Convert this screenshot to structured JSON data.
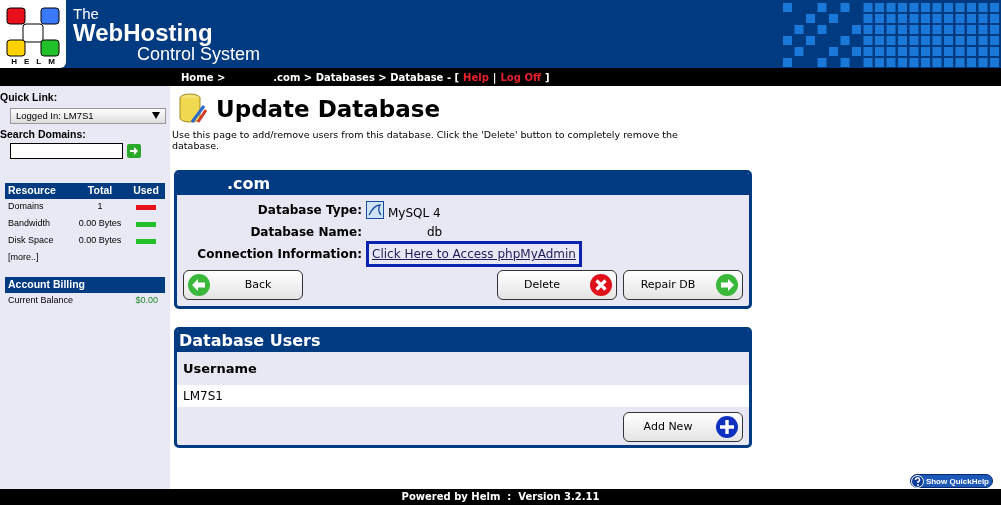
{
  "header": {
    "logo_text": "HELM",
    "title_lines": [
      "The",
      "WebHosting",
      "Control System"
    ]
  },
  "breadcrumb": [
    {
      "text": "Home >",
      "kind": "plain"
    },
    {
      "text": ".com > Databases > Database - [",
      "kind": "plain"
    },
    {
      "text": "Help",
      "kind": "link"
    },
    {
      "text": "|",
      "kind": "sep"
    },
    {
      "text": "Log Off",
      "kind": "link"
    },
    {
      "text": "]",
      "kind": "plain"
    }
  ],
  "sidebar": {
    "quick_link": {
      "label": "Quick Link:",
      "value": "Logged In: LM7S1"
    },
    "search": {
      "label": "Search Domains:"
    },
    "resources": {
      "columns": [
        "Resource",
        "Total",
        "Used"
      ],
      "rows": [
        {
          "name": "Domains",
          "total": "1",
          "color": "#e8101a"
        },
        {
          "name": "Bandwidth",
          "total": "0.00 Bytes",
          "color": "#22c02a"
        },
        {
          "name": "Disk Space",
          "total": "0.00 Bytes",
          "color": "#22c02a"
        }
      ],
      "more": "[more..]"
    },
    "billing": {
      "title": "Account Billing",
      "rows": [
        {
          "label": "Current Balance",
          "value": "$0.00"
        }
      ]
    }
  },
  "page": {
    "title": "Update Database",
    "description": "Use this page to add/remove users from this database. Click the 'Delete' button to completely remove the database."
  },
  "database_card": {
    "title": ".com",
    "fields": [
      {
        "label": "Database Type:",
        "value": "MySQL 4",
        "kind": "icon"
      },
      {
        "label": "Database Name:",
        "value": "db",
        "kind": "text"
      },
      {
        "label": "Connection Information:",
        "value": "Click Here to Access phpMyAdmin",
        "kind": "link"
      }
    ],
    "buttons": [
      {
        "label": "Back",
        "kind": "back"
      },
      {
        "label": "Delete",
        "kind": "delete"
      },
      {
        "label": "Repair DB",
        "kind": "forward"
      }
    ]
  },
  "users_card": {
    "title": "Database Users",
    "column": "Username",
    "rows": [
      "LM7S1"
    ],
    "button": {
      "label": "Add New",
      "kind": "add"
    }
  },
  "quickhelp": {
    "label": "Show QuickHelp"
  },
  "footer": "Powered by Helm  :  Version 3.2.11"
}
